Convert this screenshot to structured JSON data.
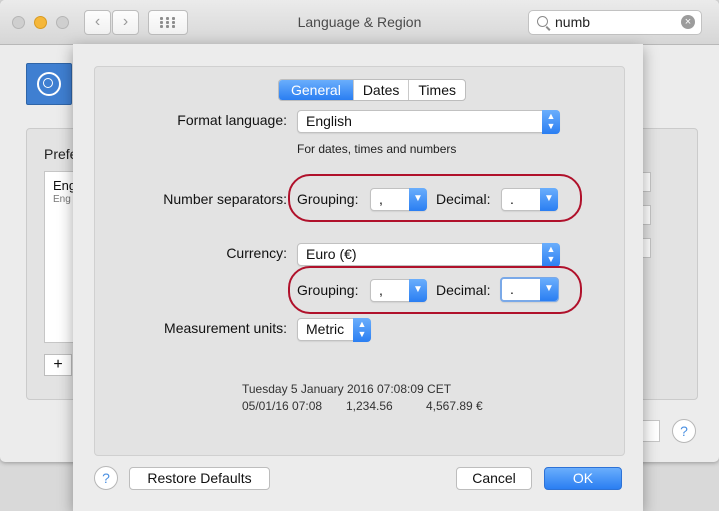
{
  "window": {
    "title": "Language & Region",
    "back_icon": "‹",
    "forward_icon": "›"
  },
  "search": {
    "value": "numb",
    "clear_icon": "×"
  },
  "background": {
    "preferred_label": "Prefe",
    "list_item_title": "Eng",
    "list_item_subtitle": "Eng",
    "add_button": "+",
    "help": "?"
  },
  "tabs": [
    {
      "label": "General",
      "selected": true
    },
    {
      "label": "Dates",
      "selected": false
    },
    {
      "label": "Times",
      "selected": false
    }
  ],
  "format_language": {
    "label": "Format language:",
    "value": "English",
    "note": "For dates, times and numbers"
  },
  "number_separators": {
    "label": "Number separators:",
    "grouping_label": "Grouping:",
    "grouping_value": ",",
    "decimal_label": "Decimal:",
    "decimal_value": "."
  },
  "currency": {
    "label": "Currency:",
    "value": "Euro (€)",
    "grouping_label": "Grouping:",
    "grouping_value": ",",
    "decimal_label": "Decimal:",
    "decimal_value": "."
  },
  "measurement": {
    "label": "Measurement units:",
    "value": "Metric"
  },
  "preview": {
    "line1": "Tuesday 5 January 2016 07:08:09 CET",
    "date_short": "05/01/16 07:08",
    "number": "1,234.56",
    "currency": "4,567.89 €"
  },
  "footer": {
    "help": "?",
    "restore": "Restore Defaults",
    "cancel": "Cancel",
    "ok": "OK"
  },
  "colors": {
    "accent": "#2a7ef2",
    "highlight_oval": "#b0112b",
    "traffic_minimize": "#f5b73a"
  }
}
